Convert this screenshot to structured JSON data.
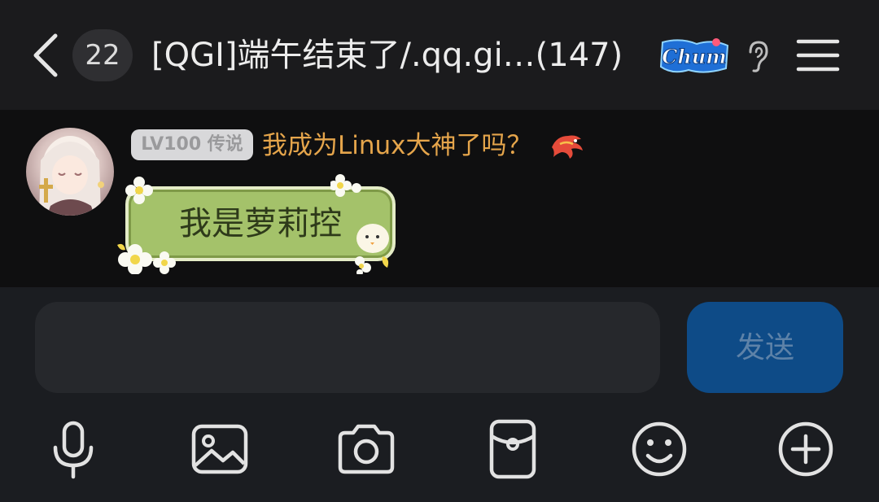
{
  "header": {
    "unread_count": "22",
    "title": "[QGI]端午结束了/.qq.gi…(147)",
    "logo_text": "Chum"
  },
  "message": {
    "level_tag": "LV100 传说",
    "sender_name": "我成为Linux大神了吗？",
    "text": "我是萝莉控"
  },
  "composer": {
    "placeholder": "",
    "send_label": "发送"
  },
  "toolbar": {
    "items": [
      "microphone-icon",
      "image-icon",
      "camera-icon",
      "red-packet-icon",
      "emoji-icon",
      "plus-icon"
    ]
  },
  "colors": {
    "header_bg": "#1b1b1d",
    "nickname": "#e5a54b",
    "bubble": "#a4c26a",
    "send_button": "#0e4b87"
  }
}
